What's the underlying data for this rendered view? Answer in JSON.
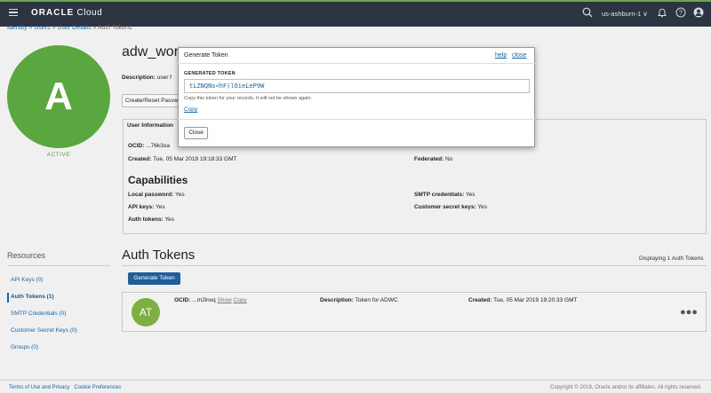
{
  "topbar": {
    "logo_brand": "ORACLE",
    "logo_suffix": " Cloud",
    "region": "us-ashburn-1 ∨",
    "icons": [
      "menu-icon",
      "search-icon",
      "bell-icon",
      "help-icon",
      "user-icon"
    ]
  },
  "breadcrumb": {
    "items": [
      "Identity",
      "Users",
      "User Details",
      "Auth Tokens"
    ],
    "separator": " » "
  },
  "user": {
    "avatar_letter": "A",
    "status": "ACTIVE",
    "name": "adw_wor",
    "description_label": "Description:",
    "description_value": "user f",
    "reset_button": "Create/Reset Passw"
  },
  "user_info": {
    "tab_label": "User Information",
    "ocid_label": "OCID:",
    "ocid_value": "...76k3oa",
    "created_label": "Created:",
    "created_value": "Tue, 05 Mar 2019 19:18:33 GMT",
    "federated_label": "Federated:",
    "federated_value": "No"
  },
  "capabilities": {
    "title": "Capabilities",
    "local_password_label": "Local password:",
    "local_password_value": "Yes",
    "api_keys_label": "API keys:",
    "api_keys_value": "Yes",
    "auth_tokens_label": "Auth tokens:",
    "auth_tokens_value": "Yes",
    "smtp_label": "SMTP credentials:",
    "smtp_value": "Yes",
    "customer_secret_label": "Customer secret keys:",
    "customer_secret_value": "Yes"
  },
  "resources": {
    "title": "Resources",
    "items": [
      "API Keys (0)",
      "Auth Tokens (1)",
      "SMTP Credentials (0)",
      "Customer Secret Keys (0)",
      "Groups (0)"
    ],
    "active_index": 1
  },
  "auth_tokens": {
    "title": "Auth Tokens",
    "display_count": "Displaying 1 Auth Tokens",
    "generate_button": "Generate Token",
    "row": {
      "avatar": "AT",
      "ocid_label": "OCID:",
      "ocid_value": "...m2lnxq",
      "show_link": "Show",
      "copy_link": "Copy",
      "description_label": "Description:",
      "description_value": "Token for ADWC",
      "created_label": "Created:",
      "created_value": "Tue, 05 Mar 2019 19:20:33 GMT"
    }
  },
  "modal": {
    "title": "Generate Token",
    "help_link": "help",
    "close_link": "close",
    "generated_label": "GENERATED TOKEN",
    "token_value": "tLZNQNs<hF(lOieLeP9W",
    "note": "Copy this token for your records. It will not be shown again.",
    "copy_link": "Copy",
    "close_button": "Close"
  },
  "footer": {
    "terms": "Terms of Use and Privacy",
    "cookies": "Cookie Preferences",
    "copyright": "Copyright © 2019, Oracle and/or its affiliates. All rights reserved."
  }
}
